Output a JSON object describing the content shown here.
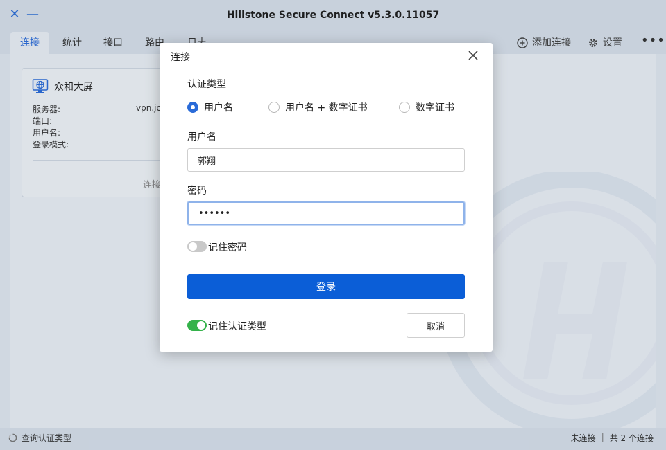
{
  "window": {
    "title": "Hillstone Secure Connect v5.3.0.11057",
    "close_glyph": "✕",
    "minimize_glyph": "—"
  },
  "tabs": [
    {
      "label": "连接",
      "active": true
    },
    {
      "label": "统计",
      "active": false
    },
    {
      "label": "接口",
      "active": false
    },
    {
      "label": "路由",
      "active": false
    },
    {
      "label": "日志",
      "active": false
    }
  ],
  "toolbar": {
    "add_connection": "添加连接",
    "settings": "设置",
    "more": "•••"
  },
  "card": {
    "name": "众和大屏",
    "server_label": "服务器:",
    "server_value": "vpn.jo",
    "port_label": "端口:",
    "username_label": "用户名:",
    "login_mode_label": "登录模式:",
    "connect_link": "连接"
  },
  "dialog": {
    "title": "连接",
    "auth_type_label": "认证类型",
    "auth_options": [
      {
        "label": "用户名",
        "selected": true
      },
      {
        "label": "用户名 + 数字证书",
        "selected": false
      },
      {
        "label": "数字证书",
        "selected": false
      }
    ],
    "username_label": "用户名",
    "username_value": "郭翔",
    "password_label": "密码",
    "password_value": "••••••",
    "remember_password": {
      "label": "记住密码",
      "on": false
    },
    "login_button": "登录",
    "remember_auth_type": {
      "label": "记住认证类型",
      "on": true
    },
    "cancel_button": "取消"
  },
  "status": {
    "left": "查询认证类型",
    "connection_state": "未连接",
    "separator": "|",
    "total": "共 2 个连接"
  },
  "colors": {
    "accent": "#2a6bd8",
    "primary_button": "#0b5ed7",
    "toggle_on": "#34b24a"
  }
}
